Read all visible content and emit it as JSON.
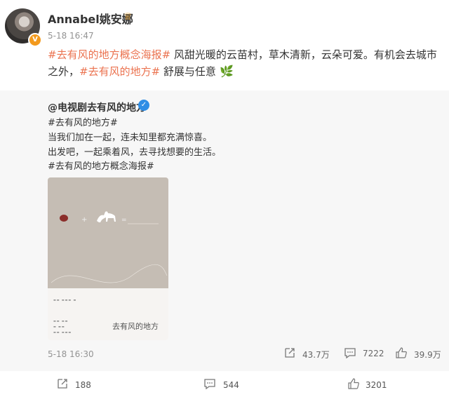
{
  "author": {
    "name": "Annabel姚安娜",
    "time": "5-18 16:47"
  },
  "post": {
    "tag1": "#去有风的地方概念海报#",
    "text1": " 风甜光暖的云苗村，草木清新，云朵可爱。有机会去城市之外，",
    "tag2": "#去有风的地方#",
    "text2": " 舒展与任意"
  },
  "repost": {
    "user": "@电视剧去有风的地方",
    "tag1": "#去有风的地方#",
    "line1": "当我们加在一起，连未知里都充满惊喜。",
    "line2": "出发吧，一起乘着风，去寻找想要的生活。",
    "tag2": "#去有风的地方概念海报#",
    "poster_title": "去有风的地方",
    "time": "5-18 16:30",
    "shares": "43.7万",
    "comments": "7222",
    "likes": "39.9万"
  },
  "actions": {
    "shares": "188",
    "comments": "544",
    "likes": "3201"
  },
  "colors": {
    "tag": "#eb7350",
    "verified": "#f39a1d",
    "repost_bg": "#f7f7f7"
  }
}
